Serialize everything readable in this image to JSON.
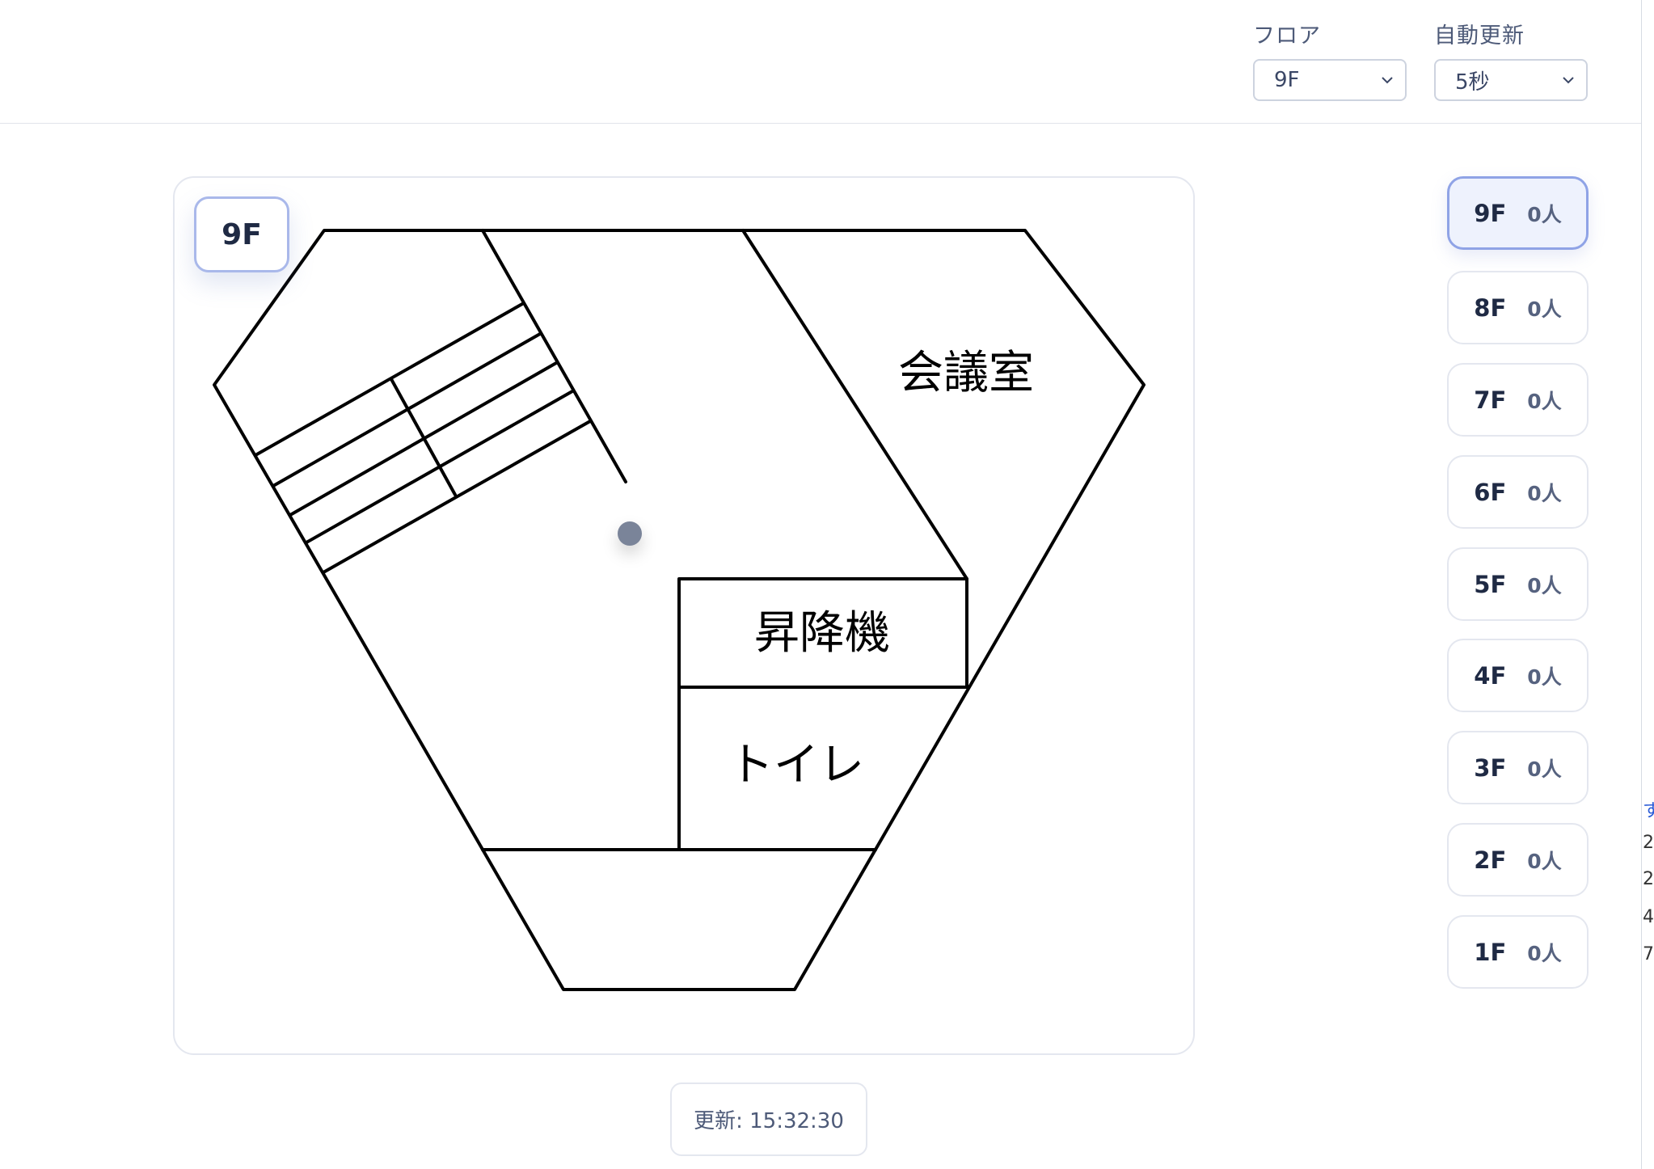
{
  "header": {
    "floor_select": {
      "label": "フロア",
      "value": "9F"
    },
    "refresh_select": {
      "label": "自動更新",
      "value": "5秒"
    }
  },
  "map": {
    "floor_badge": "9F",
    "rooms": {
      "meeting": "会議室",
      "elevator": "昇降機",
      "toilet": "トイレ"
    }
  },
  "update_text": "更新: 15:32:30",
  "floors": [
    {
      "floor": "9F",
      "count": "0人",
      "active": true
    },
    {
      "floor": "8F",
      "count": "0人",
      "active": false
    },
    {
      "floor": "7F",
      "count": "0人",
      "active": false
    },
    {
      "floor": "6F",
      "count": "0人",
      "active": false
    },
    {
      "floor": "5F",
      "count": "0人",
      "active": false
    },
    {
      "floor": "4F",
      "count": "0人",
      "active": false
    },
    {
      "floor": "3F",
      "count": "0人",
      "active": false
    },
    {
      "floor": "2F",
      "count": "0人",
      "active": false
    },
    {
      "floor": "1F",
      "count": "0人",
      "active": false
    }
  ],
  "edge_fragments": [
    "す",
    "2",
    "2",
    "4",
    "7"
  ]
}
